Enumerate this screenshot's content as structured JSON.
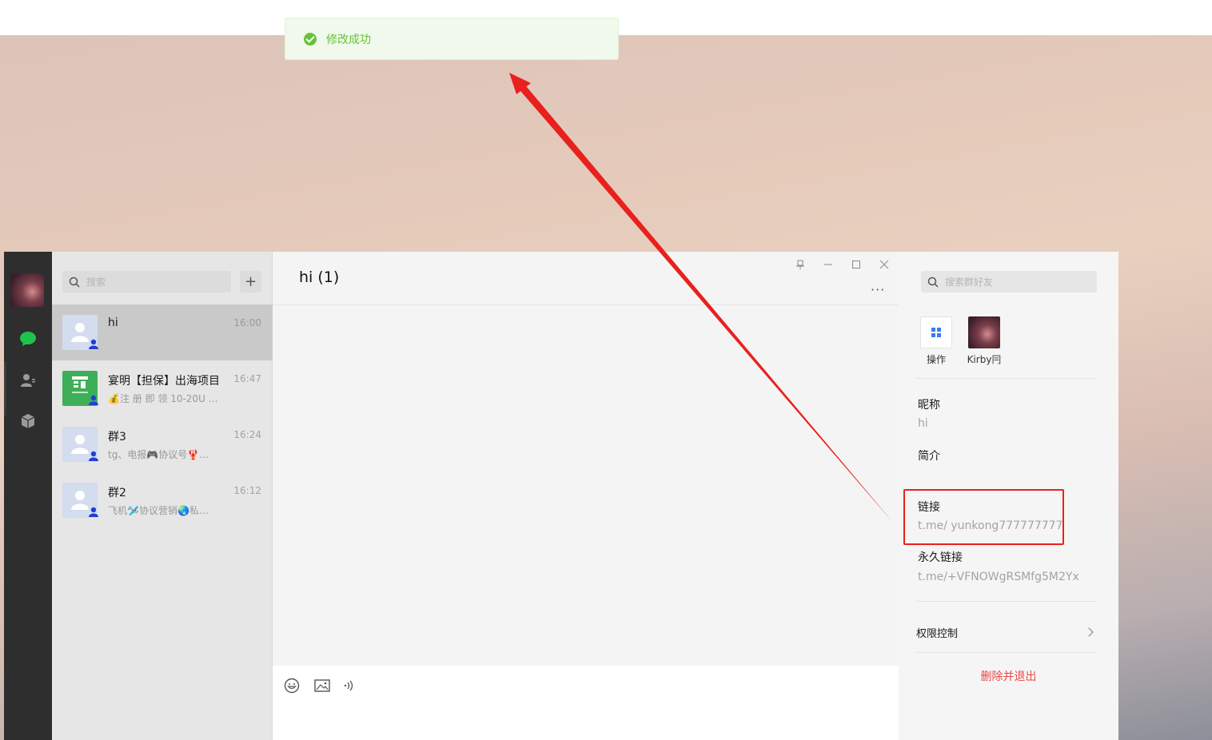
{
  "toast": {
    "text": "修改成功"
  },
  "list": {
    "search_placeholder": "搜索",
    "add_label": "+",
    "chats": [
      {
        "name": "hi",
        "time": "16:00",
        "preview": ""
      },
      {
        "name": "宴明【担保】出海项目",
        "time": "16:47",
        "preview": "💰注 册 即 领 10-20U …"
      },
      {
        "name": "群3",
        "time": "16:24",
        "preview": "tg、电报🎮协议号🦞…"
      },
      {
        "name": "群2",
        "time": "16:12",
        "preview": "飞机🛩️协议营销🌏私…"
      }
    ]
  },
  "main": {
    "title": "hi (1)",
    "more": "···"
  },
  "side": {
    "search_placeholder": "搜索群好友",
    "members": [
      {
        "label": "操作"
      },
      {
        "label": "Kirby冃"
      }
    ],
    "nickname_label": "昵称",
    "nickname_value": "hi",
    "intro_label": "简介",
    "link_label": "链接",
    "link_value": "t.me/ yunkong777777777",
    "perm_link_label": "永久链接",
    "perm_link_value": "t.me/+VFNOWgRSMfg5M2Yx",
    "permission_label": "权限控制",
    "exit_label": "删除并退出"
  },
  "colors": {
    "success": "#67c23a",
    "danger": "#e84a4a",
    "annotation": "#e8211e",
    "nav_active": "#1ec34b"
  }
}
